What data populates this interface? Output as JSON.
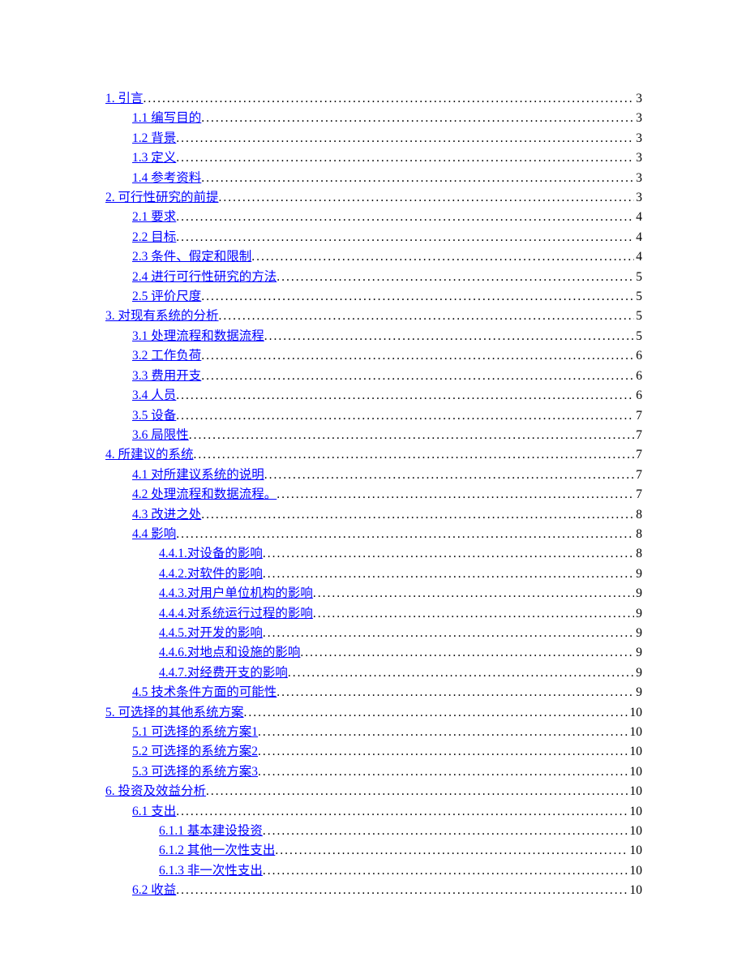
{
  "toc": [
    {
      "level": 0,
      "label": "1. 引言",
      "page": "3"
    },
    {
      "level": 1,
      "label": "1.1 编写目的",
      "page": "3"
    },
    {
      "level": 1,
      "label": "1.2 背景",
      "page": "3"
    },
    {
      "level": 1,
      "label": "1.3 定义",
      "page": "3"
    },
    {
      "level": 1,
      "label": "1.4 参考资料",
      "page": "3"
    },
    {
      "level": 0,
      "label": "2. 可行性研究的前提",
      "page": "3"
    },
    {
      "level": 1,
      "label": "2.1 要求",
      "page": "4"
    },
    {
      "level": 1,
      "label": "2.2 目标",
      "page": "4"
    },
    {
      "level": 1,
      "label": "2.3 条件、假定和限制",
      "page": "4"
    },
    {
      "level": 1,
      "label": "2.4 进行可行性研究的方法",
      "page": "5"
    },
    {
      "level": 1,
      "label": "2.5 评价尺度",
      "page": "5"
    },
    {
      "level": 0,
      "label": "3. 对现有系统的分析",
      "page": "5"
    },
    {
      "level": 1,
      "label": "3.1 处理流程和数据流程",
      "page": "5"
    },
    {
      "level": 1,
      "label": "3.2 工作负荷",
      "page": "6"
    },
    {
      "level": 1,
      "label": "3.3 费用开支",
      "page": "6"
    },
    {
      "level": 1,
      "label": "3.4 人员",
      "page": "6"
    },
    {
      "level": 1,
      "label": "3.5 设备",
      "page": "7"
    },
    {
      "level": 1,
      "label": "3.6 局限性",
      "page": "7"
    },
    {
      "level": 0,
      "label": "4. 所建议的系统",
      "page": "7"
    },
    {
      "level": 1,
      "label": "4.1 对所建议系统的说明",
      "page": "7"
    },
    {
      "level": 1,
      "label": "4.2 处理流程和数据流程。",
      "page": "7"
    },
    {
      "level": 1,
      "label": "4.3 改进之处",
      "page": "8"
    },
    {
      "level": 1,
      "label": "4.4 影响",
      "page": "8"
    },
    {
      "level": 2,
      "label": "4.4.1.对设备的影响",
      "page": "8"
    },
    {
      "level": 2,
      "label": "4.4.2.对软件的影响",
      "page": "9"
    },
    {
      "level": 2,
      "label": "4.4.3.对用户单位机构的影响",
      "page": "9"
    },
    {
      "level": 2,
      "label": "4.4.4.对系统运行过程的影响",
      "page": "9"
    },
    {
      "level": 2,
      "label": "4.4.5.对开发的影响",
      "page": "9"
    },
    {
      "level": 2,
      "label": "4.4.6.对地点和设施的影响",
      "page": "9"
    },
    {
      "level": 2,
      "label": "4.4.7.对经费开支的影响",
      "page": "9"
    },
    {
      "level": 1,
      "label": "4.5 技术条件方面的可能性",
      "page": "9"
    },
    {
      "level": 0,
      "label": "5. 可选择的其他系统方案",
      "page": "10"
    },
    {
      "level": 1,
      "label": "5.1 可选择的系统方案1",
      "page": "10"
    },
    {
      "level": 1,
      "label": "5.2 可选择的系统方案2",
      "page": "10"
    },
    {
      "level": 1,
      "label": "5.3 可选择的系统方案3",
      "page": "10"
    },
    {
      "level": 0,
      "label": "6. 投资及效益分析",
      "page": "10"
    },
    {
      "level": 1,
      "label": "6.1 支出",
      "page": "10"
    },
    {
      "level": 2,
      "label": "6.1.1 基本建设投资",
      "page": "10"
    },
    {
      "level": 2,
      "label": "6.1.2 其他一次性支出",
      "page": "10"
    },
    {
      "level": 2,
      "label": "6.1.3 非一次性支出",
      "page": "10"
    },
    {
      "level": 1,
      "label": "6.2 收益",
      "page": "10"
    }
  ]
}
